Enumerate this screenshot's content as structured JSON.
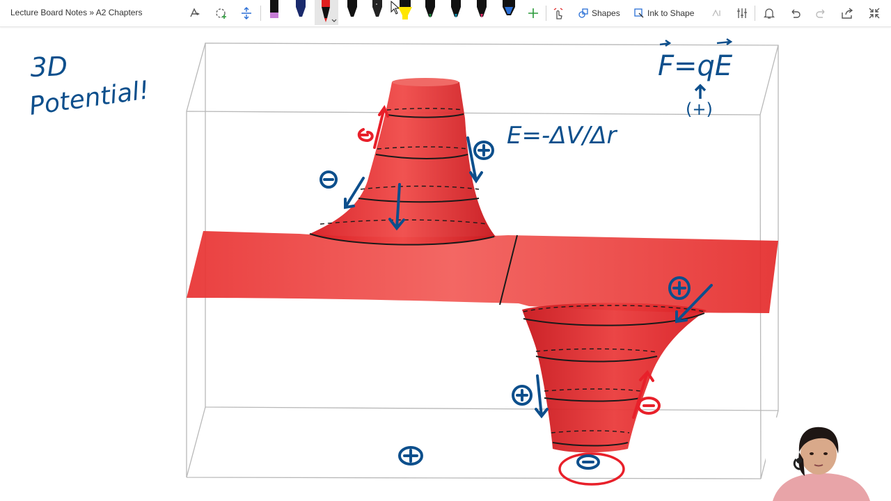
{
  "toolbar": {
    "breadcrumb": "Lecture Board Notes » A2 Chapters",
    "shapes_label": "Shapes",
    "ink_to_shape_label": "Ink to Shape",
    "pens": [
      {
        "name": "black-pen",
        "color": "#111111",
        "tip": "#c77dd6"
      },
      {
        "name": "navy-pen",
        "color": "#1a2a6c",
        "tip": "#1a2a6c"
      },
      {
        "name": "red-pen",
        "color": "#e02020",
        "tip": "#e02020"
      },
      {
        "name": "black-pen-2",
        "color": "#111111",
        "tip": "#111111"
      },
      {
        "name": "black-pen-3",
        "color": "#111111",
        "tip": "#111111"
      },
      {
        "name": "yellow-highlighter",
        "color": "#ffe600",
        "tip": "#ffe600"
      },
      {
        "name": "green-pen",
        "color": "#1a8a3a",
        "tip": "#1a8a3a"
      },
      {
        "name": "teal-pen",
        "color": "#0a8fb0",
        "tip": "#0a8fb0"
      },
      {
        "name": "pink-pen",
        "color": "#e0306a",
        "tip": "#e0306a"
      },
      {
        "name": "blue-pen",
        "color": "#2a6fd6",
        "tip": "#2a6fd6"
      }
    ]
  },
  "notes": {
    "title_line1": "3D",
    "title_line2": "Potential!",
    "eq_force": "F=qE",
    "eq_field": "E=-ΔV/Δr",
    "charge_plus": "(+)"
  },
  "colors": {
    "ink_blue": "#0d4f8c",
    "ink_red": "#e8202a",
    "surface": "#e8262a"
  }
}
